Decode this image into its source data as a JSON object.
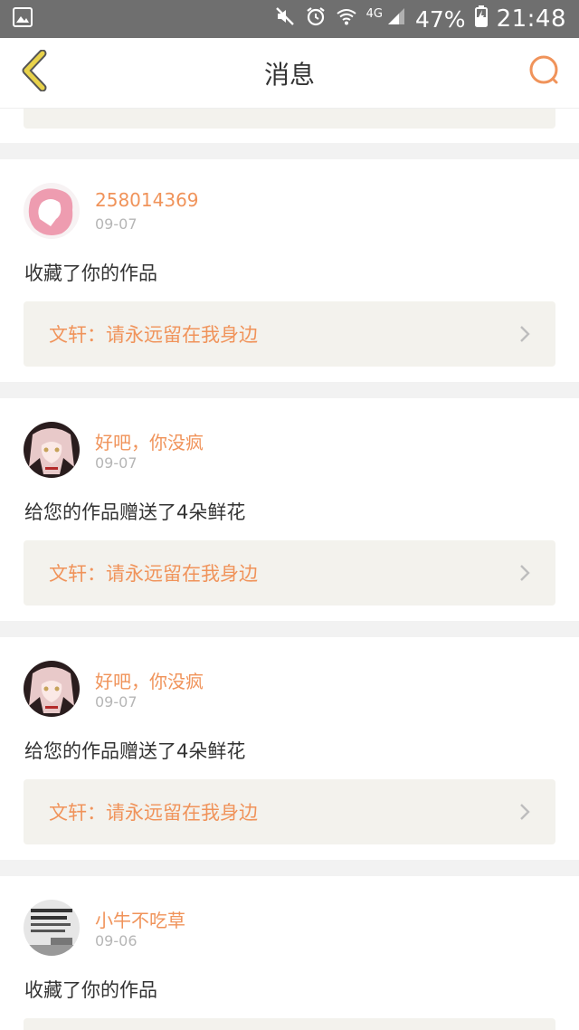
{
  "status_bar": {
    "battery": "47%",
    "network": "4G",
    "time": "21:48",
    "icons": [
      "gallery-icon",
      "mute-icon",
      "alarm-icon",
      "wifi-icon",
      "signal-icon",
      "battery-charging-icon"
    ]
  },
  "header": {
    "title": "消息",
    "accent_color": "#f0935a",
    "back_icon_color": "#e8d24a"
  },
  "messages": [
    {
      "username": "258014369",
      "date": "09-07",
      "action": "收藏了你的作品",
      "work": "文轩：请永远留在我身边"
    },
    {
      "username": "好吧，你没疯",
      "date": "09-07",
      "action": "给您的作品赠送了4朵鲜花",
      "work": "文轩：请永远留在我身边"
    },
    {
      "username": "好吧，你没疯",
      "date": "09-07",
      "action": "给您的作品赠送了4朵鲜花",
      "work": "文轩：请永远留在我身边"
    },
    {
      "username": "小牛不吃草",
      "date": "09-06",
      "action": "收藏了你的作品"
    }
  ]
}
